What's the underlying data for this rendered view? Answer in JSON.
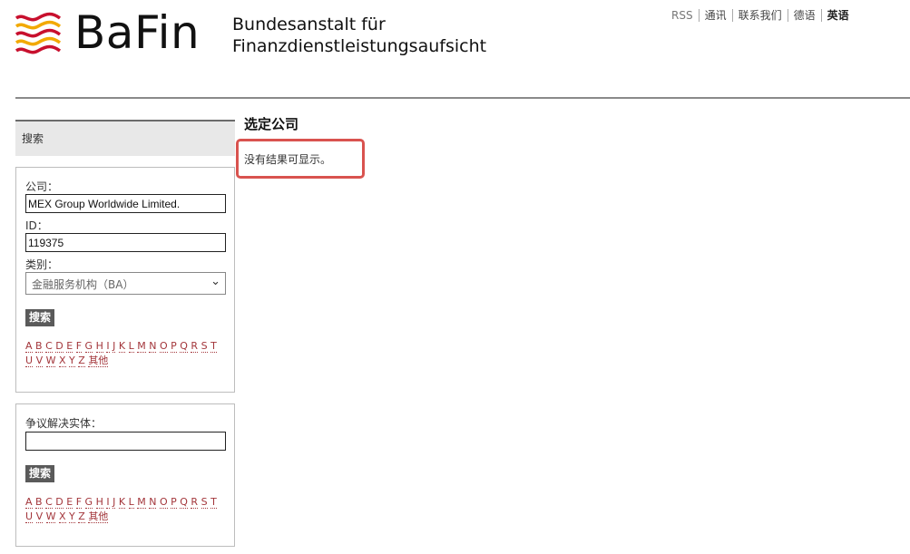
{
  "header": {
    "logo_icon": "bafin-waves-icon",
    "brand": "BaFin",
    "subtitle_line1": "Bundesanstalt für",
    "subtitle_line2": "Finanzdienstleistungsaufsicht",
    "brand_colors": {
      "red": "#c8102e",
      "gold": "#f2a900"
    }
  },
  "topnav": {
    "rss": "RSS",
    "contact": "通讯",
    "contact_us": "联系我们",
    "german": "德语",
    "english": "英语"
  },
  "sidebar": {
    "search_tab": "搜索",
    "company_search": {
      "company_label": "公司：",
      "company_value": "MEX Group Worldwide Limited.",
      "id_label": "ID：",
      "id_value": "119375",
      "category_label": "类别：",
      "category_value": "金融服务机构（BA）",
      "search_button": "搜索",
      "alphabet": [
        "A",
        "B",
        "C",
        "D",
        "E",
        "F",
        "G",
        "H",
        "I",
        "J",
        "K",
        "L",
        "M",
        "N",
        "O",
        "P",
        "Q",
        "R",
        "S",
        "T",
        "U",
        "V",
        "W",
        "X",
        "Y",
        "Z"
      ],
      "other": "其他"
    },
    "dispute_search": {
      "label": "争议解决实体：",
      "value": "",
      "search_button": "搜索",
      "alphabet": [
        "A",
        "B",
        "C",
        "D",
        "E",
        "F",
        "G",
        "H",
        "I",
        "J",
        "K",
        "L",
        "M",
        "N",
        "O",
        "P",
        "Q",
        "R",
        "S",
        "T",
        "U",
        "V",
        "W",
        "X",
        "Y",
        "Z"
      ],
      "other": "其他"
    }
  },
  "main": {
    "title": "选定公司",
    "no_results": "没有结果可显示。",
    "highlight_color": "#d9534f"
  }
}
